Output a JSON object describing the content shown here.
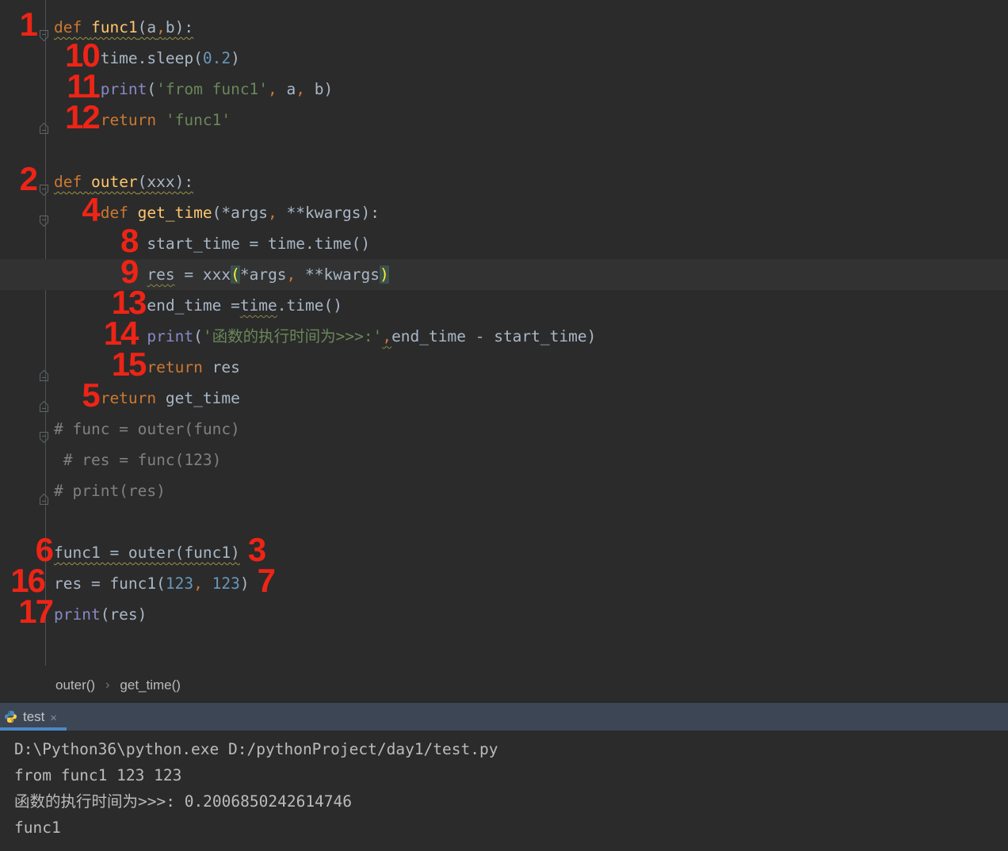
{
  "editor": {
    "lines": [
      {
        "indent": 0,
        "fold": "start",
        "ann": {
          "t": "1",
          "shift": true
        },
        "wavy": true,
        "tokens": [
          {
            "t": "def ",
            "c": "kw"
          },
          {
            "t": "func1",
            "c": "fn"
          },
          {
            "t": "(a",
            "c": "tx"
          },
          {
            "t": ",",
            "c": "comma"
          },
          {
            "t": "b):",
            "c": "tx"
          }
        ]
      },
      {
        "indent": 5,
        "ann": {
          "t": "10"
        },
        "tokens": [
          {
            "t": "time.sleep(",
            "c": "tx"
          },
          {
            "t": "0.2",
            "c": "num"
          },
          {
            "t": ")",
            "c": "tx"
          }
        ]
      },
      {
        "indent": 5,
        "ann": {
          "t": "11"
        },
        "tokens": [
          {
            "t": "print",
            "c": "bi"
          },
          {
            "t": "(",
            "c": "tx"
          },
          {
            "t": "'from func1'",
            "c": "str"
          },
          {
            "t": ",",
            "c": "comma"
          },
          {
            "t": " a",
            "c": "tx"
          },
          {
            "t": ",",
            "c": "comma"
          },
          {
            "t": " b)",
            "c": "tx"
          }
        ]
      },
      {
        "indent": 5,
        "fold": "end",
        "ann": {
          "t": "12"
        },
        "tokens": [
          {
            "t": "return ",
            "c": "kw"
          },
          {
            "t": "'func1'",
            "c": "str"
          }
        ]
      },
      {
        "indent": 0,
        "tokens": []
      },
      {
        "indent": 0,
        "fold": "start",
        "ann": {
          "t": "2",
          "shift": true
        },
        "wavy": true,
        "tokens": [
          {
            "t": "def ",
            "c": "kw"
          },
          {
            "t": "outer",
            "c": "fn"
          },
          {
            "t": "(xxx):",
            "c": "tx"
          }
        ]
      },
      {
        "indent": 5,
        "fold": "start",
        "ann": {
          "t": "4"
        },
        "tokens": [
          {
            "t": "def ",
            "c": "kw"
          },
          {
            "t": "get_time",
            "c": "fn"
          },
          {
            "t": "(*args",
            "c": "tx"
          },
          {
            "t": ",",
            "c": "comma"
          },
          {
            "t": " **kwargs):",
            "c": "tx"
          }
        ]
      },
      {
        "indent": 10,
        "ann": {
          "t": "8",
          "gap": true
        },
        "tokens": [
          {
            "t": "start_time = time.time()",
            "c": "tx"
          }
        ]
      },
      {
        "indent": 10,
        "ann": {
          "t": "9",
          "gap": true
        },
        "highlight": true,
        "tokens": [
          {
            "t": "res",
            "c": "tx",
            "wavy": true
          },
          {
            "t": " = xxx",
            "c": "tx"
          },
          {
            "t": "(",
            "c": "brace"
          },
          {
            "t": "*args",
            "c": "tx"
          },
          {
            "t": ",",
            "c": "comma"
          },
          {
            "t": " **kwargs",
            "c": "tx"
          },
          {
            "t": ")",
            "c": "brace"
          }
        ]
      },
      {
        "indent": 10,
        "ann": {
          "t": "13"
        },
        "tokens": [
          {
            "t": "end_time =",
            "c": "tx"
          },
          {
            "t": "time",
            "c": "tx",
            "wavy": true
          },
          {
            "t": ".time()",
            "c": "tx"
          }
        ]
      },
      {
        "indent": 10,
        "ann": {
          "t": "14",
          "gap": true
        },
        "tokens": [
          {
            "t": "print",
            "c": "bi"
          },
          {
            "t": "(",
            "c": "tx"
          },
          {
            "t": "'函数的执行时间为>>>:'",
            "c": "str"
          },
          {
            "t": ",",
            "c": "comma",
            "wavy": true
          },
          {
            "t": "end_time - start_time)",
            "c": "tx"
          }
        ]
      },
      {
        "indent": 10,
        "fold": "end",
        "ann": {
          "t": "15"
        },
        "tokens": [
          {
            "t": "return ",
            "c": "kw"
          },
          {
            "t": "res",
            "c": "tx"
          }
        ]
      },
      {
        "indent": 5,
        "fold": "end",
        "ann": {
          "t": "5"
        },
        "tokens": [
          {
            "t": "return ",
            "c": "kw"
          },
          {
            "t": "get_time",
            "c": "tx"
          }
        ]
      },
      {
        "indent": 0,
        "fold": "start",
        "tokens": [
          {
            "t": "# func = outer(func)",
            "c": "cm"
          }
        ]
      },
      {
        "indent": 1,
        "tokens": [
          {
            "t": "# res = func(123)",
            "c": "cm"
          }
        ]
      },
      {
        "indent": 0,
        "fold": "end",
        "tokens": [
          {
            "t": "# print(res)",
            "c": "cm"
          }
        ]
      },
      {
        "indent": 0,
        "tokens": []
      },
      {
        "indent": 0,
        "ann": {
          "t": "6"
        },
        "ann_right": {
          "t": "3"
        },
        "wavy": true,
        "tokens": [
          {
            "t": "func1 = outer(func1)",
            "c": "tx"
          }
        ]
      },
      {
        "indent": 0,
        "ann": {
          "t": "16",
          "gap": true
        },
        "ann_right": {
          "t": "7"
        },
        "tokens": [
          {
            "t": "res = func1(",
            "c": "tx"
          },
          {
            "t": "123",
            "c": "num"
          },
          {
            "t": ",",
            "c": "comma"
          },
          {
            "t": " ",
            "c": "tx"
          },
          {
            "t": "123",
            "c": "num"
          },
          {
            "t": ")",
            "c": "tx"
          }
        ]
      },
      {
        "indent": 0,
        "ann": {
          "t": "17"
        },
        "tokens": [
          {
            "t": "print",
            "c": "bi"
          },
          {
            "t": "(res)",
            "c": "tx"
          }
        ]
      }
    ]
  },
  "breadcrumbs": {
    "items": [
      "outer()",
      "get_time()"
    ],
    "separator": "›"
  },
  "run_panel": {
    "tab": {
      "label": "test",
      "close_label": "✕",
      "icon": "python-icon"
    },
    "console_lines": [
      "D:\\Python36\\python.exe D:/pythonProject/day1/test.py",
      "from func1 123 123",
      "函数的执行时间为>>>: 0.2006850242614746",
      "func1"
    ]
  },
  "colors": {
    "editor_bg": "#2b2b2b",
    "current_line_bg": "#323232",
    "annotation_red": "#ee2416",
    "keyword_orange": "#CC7832",
    "function_yellow": "#FFC66D",
    "string_green": "#6A8759",
    "number_blue": "#6897BB",
    "builtin_purple": "#8888C6",
    "comment_gray": "#808080",
    "default_text": "#A9B7C6",
    "matched_paren": "#FFEF28",
    "matched_paren_bg": "#3B514D",
    "tabbar_bg": "#3c4655",
    "active_tab_underline": "#4a88c7",
    "console_text": "#bbbbbb"
  }
}
